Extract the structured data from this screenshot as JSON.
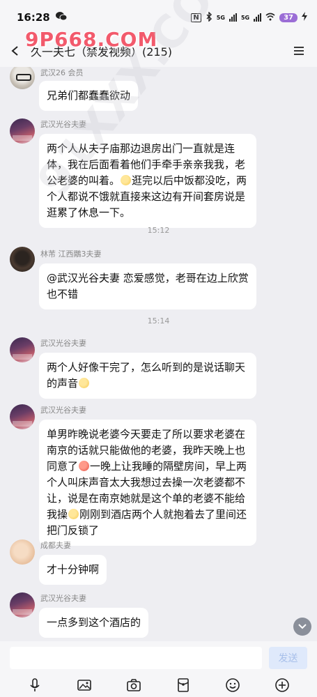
{
  "status_bar": {
    "time": "16:28",
    "battery": "37",
    "network_label": "5G",
    "nfc_label": "N"
  },
  "header": {
    "title": "久一夫七（禁发视频）(215)"
  },
  "watermarks": {
    "top": "9P668.COM",
    "diagonal": "91XXX.COM"
  },
  "messages": [
    {
      "sender": "武汉26 会员",
      "text": "兄弟们都蠢蠢欲动",
      "avatar": "avatar-wuhan26"
    },
    {
      "sender": "武汉光谷夫妻",
      "text_before": "两个人从夫子庙那边退房出门一直就是连体，我在后面看着他们手牵手亲亲我我，老公老婆的叫着。",
      "text_after": "逛完以后中饭都没吃，两个人都说不饿就直接来这边有开间套房说是逛累了休息一下。",
      "avatar": "avatar-guanggu"
    },
    {
      "sender": "林芾 江西鷴3夫妻",
      "text": "@武汉光谷夫妻 恋爱感觉，老哥在边上欣赏也不错",
      "avatar": "avatar-lindi"
    },
    {
      "sender": "武汉光谷夫妻",
      "text": "两个人好像干完了，怎么听到的是说话聊天的声音",
      "avatar": "avatar-guanggu"
    },
    {
      "sender": "武汉光谷夫妻",
      "text_part1": "单男昨晚说老婆今天要走了所以要求老婆在南京的话就只能做他的老婆，我昨天晚上也同意了",
      "text_part2": "一晚上让我睡的隔壁房间，早上两个人叫床声音太大我想过去操一次老婆都不让，说是在南京她就是这个单的老婆不能给我操",
      "text_part3": "刚刚到酒店两个人就抱着去了里间还把门反锁了",
      "avatar": "avatar-guanggu"
    },
    {
      "sender": "成都夫妻",
      "text": "才十分钟啊",
      "avatar": "avatar-chengdu"
    },
    {
      "sender": "武汉光谷夫妻",
      "text": "一点多到这个酒店的",
      "avatar": "avatar-guanggu"
    }
  ],
  "time_dividers": [
    "15:12",
    "15:14"
  ],
  "input": {
    "placeholder": "",
    "send_label": "发送"
  },
  "toolbar_icons": [
    "microphone-icon",
    "image-icon",
    "camera-icon",
    "red-packet-icon",
    "emoji-icon",
    "plus-icon"
  ]
}
